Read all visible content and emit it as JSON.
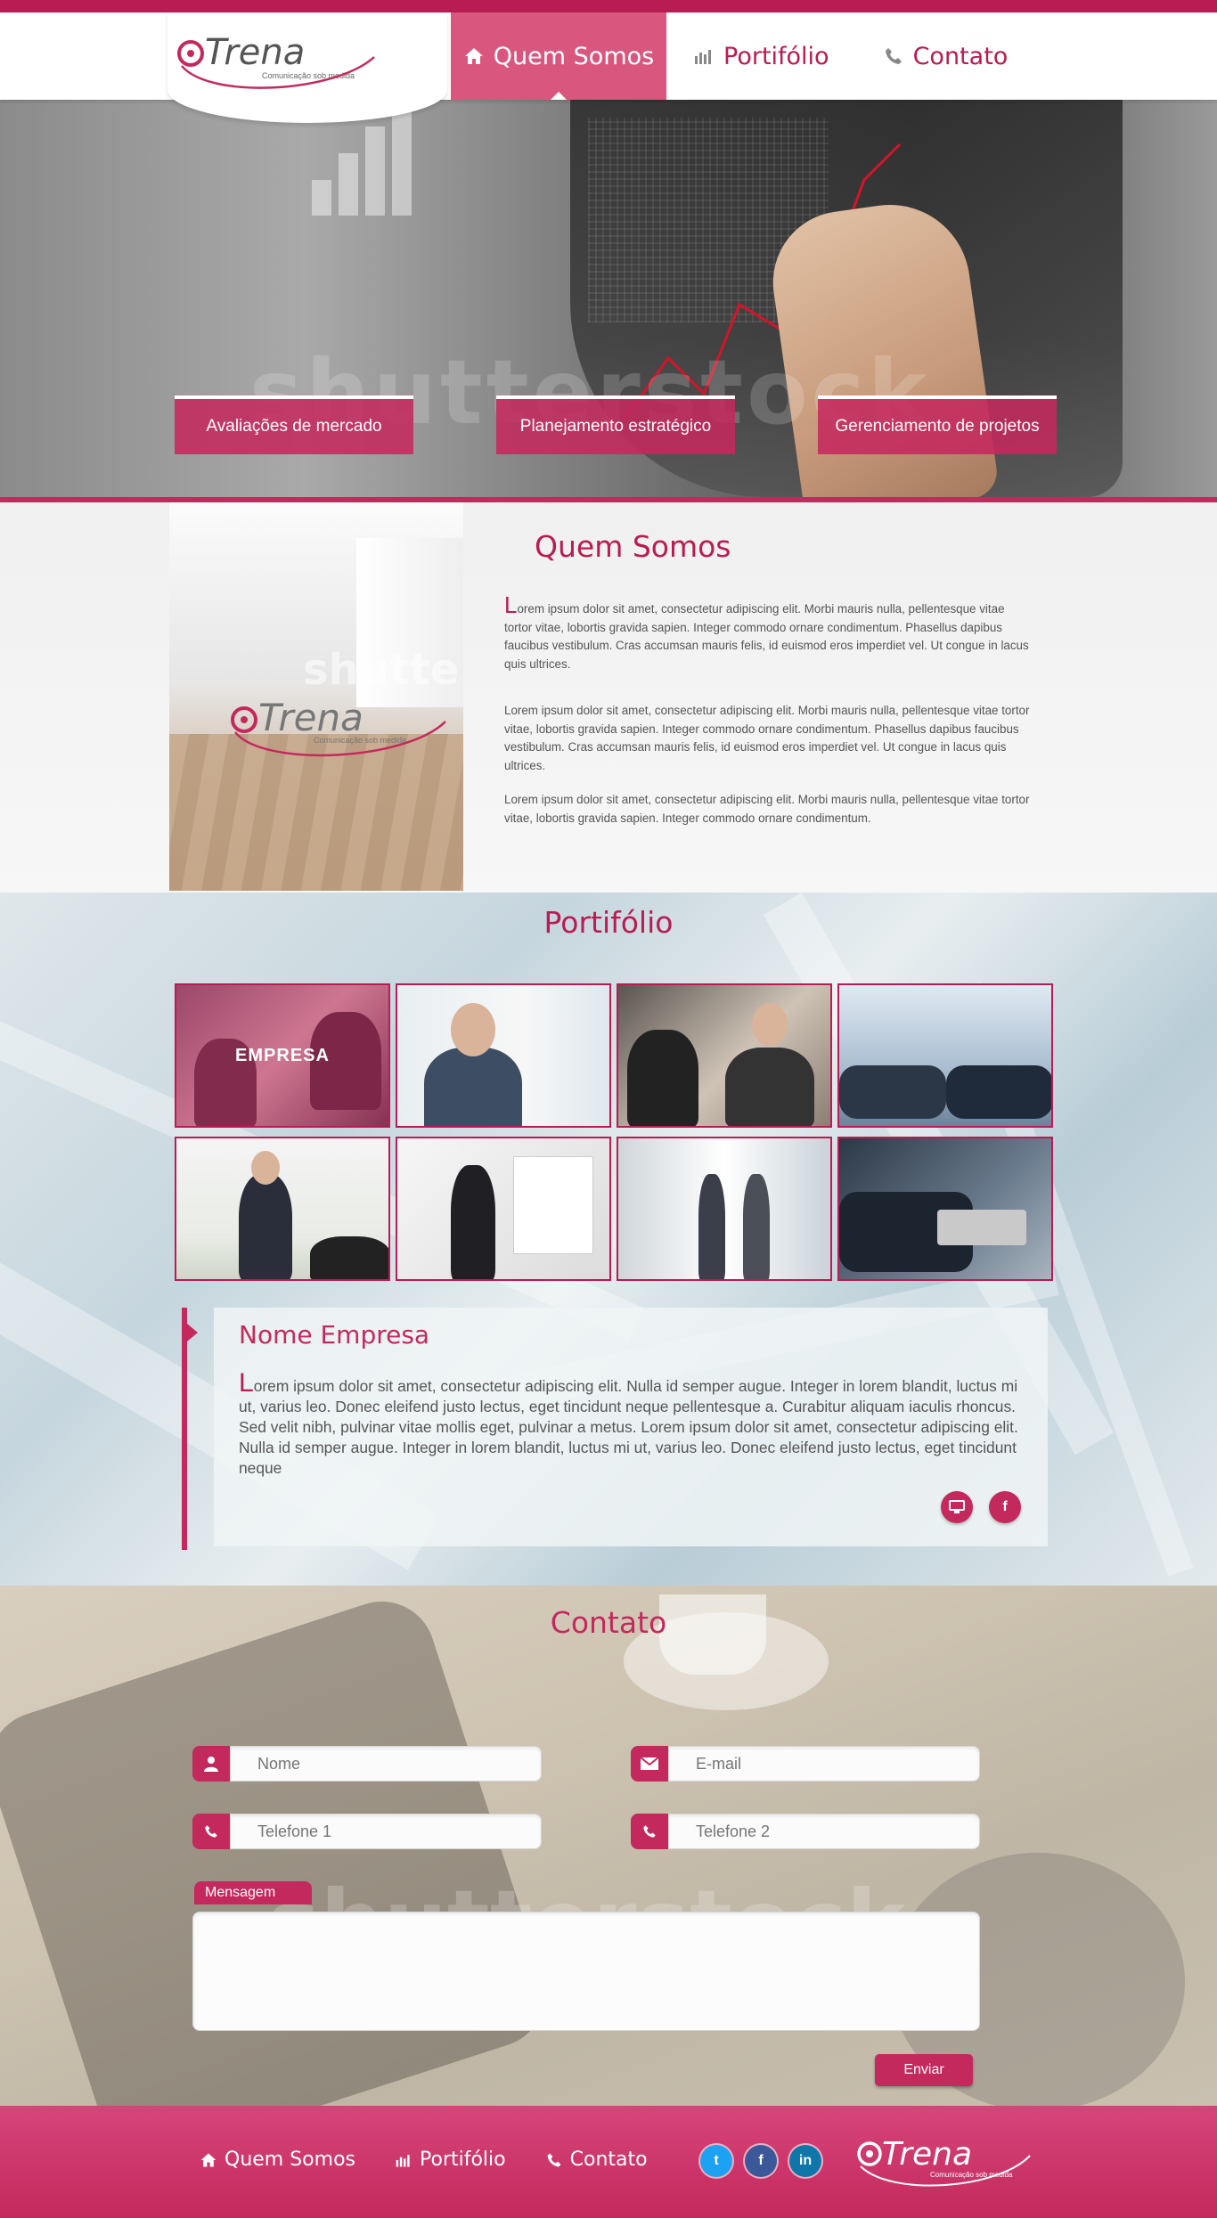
{
  "brand": {
    "name": "Trena",
    "tagline": "Comunicação sob medida",
    "primary_color": "#c4295d",
    "dark_color": "#b81c52"
  },
  "nav": {
    "items": [
      {
        "label": "Quem Somos",
        "icon": "home-icon",
        "active": true
      },
      {
        "label": "Portifólio",
        "icon": "bar-chart-icon",
        "active": false
      },
      {
        "label": "Contato",
        "icon": "phone-icon",
        "active": false
      }
    ]
  },
  "hero": {
    "watermark": "shutterstock",
    "tabs": [
      "Avaliações de mercado",
      "Planejamento estratégico",
      "Gerenciamento de projetos"
    ]
  },
  "about": {
    "title": "Quem Somos",
    "image_watermark": "shutte",
    "p1_dropcap": "L",
    "p1": "orem ipsum dolor sit amet, consectetur adipiscing elit. Morbi mauris nulla, pellentesque vitae tortor vitae, lobortis gravida sapien. Integer commodo ornare condimentum. Phasellus dapibus faucibus vestibulum. Cras accumsan mauris felis, id euismod eros imperdiet vel. Ut congue in lacus quis ultrices.",
    "p2": "Lorem ipsum dolor sit amet, consectetur adipiscing elit. Morbi mauris nulla, pellentesque vitae tortor vitae, lobortis gravida sapien. Integer commodo ornare condimentum. Phasellus dapibus faucibus vestibulum. Cras accumsan mauris felis, id euismod eros imperdiet vel. Ut congue in lacus quis ultrices.",
    "p3": "Lorem ipsum dolor sit amet, consectetur adipiscing elit. Morbi mauris nulla, pellentesque vitae tortor vitae, lobortis gravida sapien. Integer commodo ornare condimentum."
  },
  "portfolio": {
    "title": "Portifólio",
    "tiles": [
      {
        "overlay": "EMPRESA",
        "scene": "meeting-table"
      },
      {
        "overlay": "",
        "scene": "smiling-businessman"
      },
      {
        "overlay": "",
        "scene": "team-discussion"
      },
      {
        "overlay": "",
        "scene": "handshake"
      },
      {
        "overlay": "",
        "scene": "presentation"
      },
      {
        "overlay": "",
        "scene": "flipchart"
      },
      {
        "overlay": "",
        "scene": "office-walk"
      },
      {
        "overlay": "",
        "scene": "tablet"
      }
    ],
    "company_title": "Nome Empresa",
    "company_dropcap": "L",
    "company_text": "orem ipsum dolor sit amet, consectetur adipiscing elit. Nulla id semper augue. Integer in lorem blandit, luctus mi ut, varius leo. Donec eleifend justo lectus, eget tincidunt neque pellentesque a. Curabitur aliquam iaculis rhoncus. Sed velit nibh, pulvinar vitae mollis eget, pulvinar a metus. Lorem ipsum dolor sit amet, consectetur adipiscing elit. Nulla id semper augue. Integer in lorem blandit, luctus mi ut, varius leo. Donec eleifend justo lectus, eget tincidunt neque",
    "company_icons": [
      "monitor-icon",
      "facebook-icon"
    ]
  },
  "contact": {
    "title": "Contato",
    "watermark": "shutterstock",
    "fields": [
      {
        "placeholder": "Nome",
        "icon": "user-icon"
      },
      {
        "placeholder": "E-mail",
        "icon": "envelope-icon"
      },
      {
        "placeholder": "Telefone 1",
        "icon": "phone-icon"
      },
      {
        "placeholder": "Telefone 2",
        "icon": "phone-icon"
      }
    ],
    "message_label": "Mensagem",
    "submit_label": "Enviar"
  },
  "footer": {
    "nav": [
      "Quem Somos",
      "Portifólio",
      "Contato"
    ],
    "social": [
      {
        "name": "twitter-icon",
        "glyph": "t",
        "color": "#1da1f2"
      },
      {
        "name": "facebook-icon",
        "glyph": "f",
        "color": "#3b5998"
      },
      {
        "name": "linkedin-icon",
        "glyph": "in",
        "color": "#0e76a8"
      }
    ]
  }
}
